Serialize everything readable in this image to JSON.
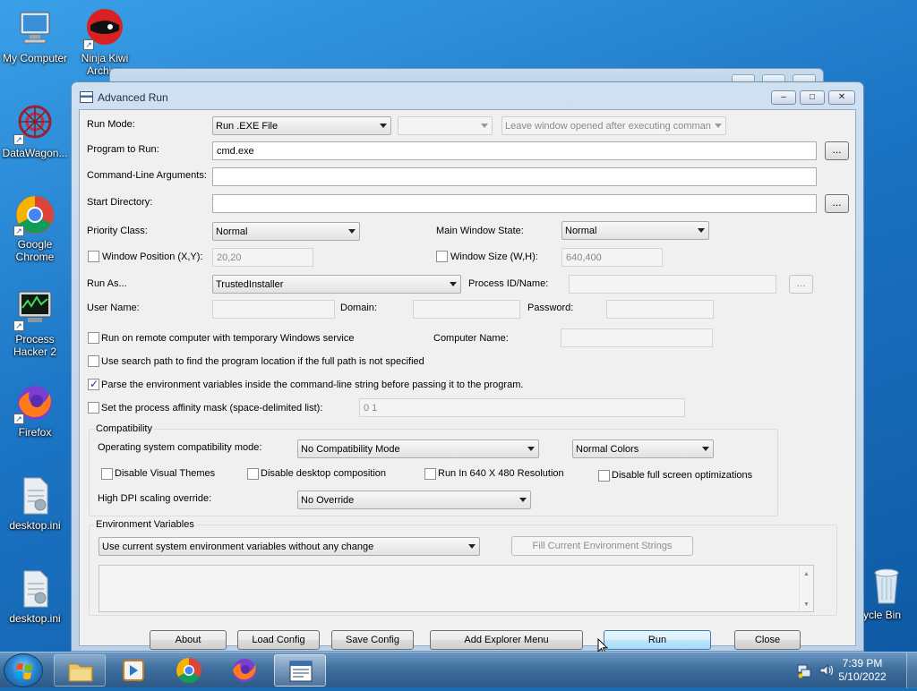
{
  "desktop": {
    "icons": [
      {
        "label": "My Computer",
        "icon": "computer-icon"
      },
      {
        "label": "Ninja Kiwi Archive",
        "icon": "ninja-kiwi-icon"
      },
      {
        "label": "DataWagon...",
        "icon": "datawagon-icon"
      },
      {
        "label": "Google Chrome",
        "icon": "chrome-icon"
      },
      {
        "label": "Process Hacker 2",
        "icon": "process-hacker-icon"
      },
      {
        "label": "Firefox",
        "icon": "firefox-icon"
      },
      {
        "label": "desktop.ini",
        "icon": "ini-file-icon"
      },
      {
        "label": "desktop.ini",
        "icon": "ini-file-icon"
      },
      {
        "label": "ycle Bin",
        "icon": "recycle-bin-icon"
      }
    ]
  },
  "window": {
    "title": "Advanced Run",
    "minimize": "‒",
    "maximize": "□",
    "close": "✕"
  },
  "form": {
    "run_mode_label": "Run Mode:",
    "run_mode_value": "Run .EXE File",
    "run_mode_secondary": "",
    "after_exec_value": "Leave window opened after executing comman",
    "program_label": "Program to Run:",
    "program_value": "cmd.exe",
    "browse_label": "...",
    "args_label": "Command-Line Arguments:",
    "args_value": "",
    "start_dir_label": "Start Directory:",
    "start_dir_value": "",
    "priority_label": "Priority Class:",
    "priority_value": "Normal",
    "main_state_label": "Main Window State:",
    "main_state_value": "Normal",
    "win_pos_label": "Window Position (X,Y):",
    "win_pos_value": "20,20",
    "win_size_label": "Window Size (W,H):",
    "win_size_value": "640,400",
    "run_as_label": "Run As...",
    "run_as_value": "TrustedInstaller",
    "pid_label": "Process ID/Name:",
    "pid_value": "",
    "user_label": "User Name:",
    "domain_label": "Domain:",
    "password_label": "Password:",
    "remote_label": "Run on remote computer with temporary Windows service",
    "computer_name_label": "Computer Name:",
    "search_path_label": "Use search path to find the program location if the full path is not specified",
    "parse_env_label": "Parse the environment variables inside the command-line string before passing it to the program.",
    "affinity_label": "Set the process affinity mask (space-delimited list):",
    "affinity_value": "0 1"
  },
  "compat": {
    "title": "Compatibility",
    "os_mode_label": "Operating system compatibility mode:",
    "os_mode_value": "No Compatibility Mode",
    "colors_value": "Normal Colors",
    "disable_themes": "Disable Visual Themes",
    "disable_composition": "Disable desktop composition",
    "run_640": "Run In 640 X 480 Resolution",
    "disable_fullscreen": "Disable full screen optimizations",
    "dpi_label": "High DPI scaling override:",
    "dpi_value": "No Override"
  },
  "env": {
    "title": "Environment Variables",
    "mode_value": "Use current system environment variables without any change",
    "fill_button": "Fill Current Environment Strings"
  },
  "buttons": {
    "about": "About",
    "load": "Load Config",
    "save": "Save Config",
    "explorer": "Add Explorer Menu",
    "run": "Run",
    "close": "Close"
  },
  "taskbar": {
    "time": "7:39 PM",
    "date": "5/10/2022"
  }
}
